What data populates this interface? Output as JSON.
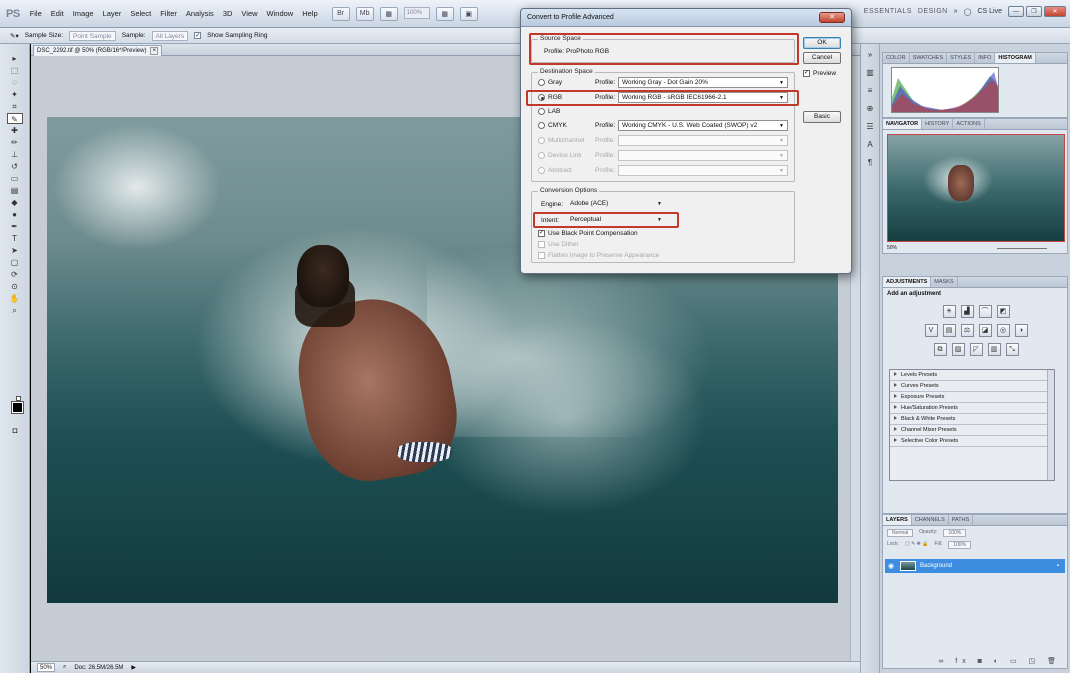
{
  "app": {
    "logo": "PS",
    "menu": [
      "File",
      "Edit",
      "Image",
      "Layer",
      "Select",
      "Filter",
      "Analysis",
      "3D",
      "View",
      "Window",
      "Help"
    ],
    "zoom": "100%",
    "workspaces": [
      "ESSENTIALS",
      "DESIGN",
      "»"
    ],
    "cslive": "CS Live"
  },
  "options_bar": {
    "sample_size_label": "Sample Size:",
    "sample_size_value": "Point Sample",
    "sample_label": "Sample:",
    "sample_value": "All Layers",
    "show_ring_label": "Show Sampling Ring"
  },
  "document": {
    "tab_title": "DSC_2292.tif @ 50% (RGB/16*/Preview)",
    "status_zoom": "50%",
    "status_doc": "Doc: 26.5M/26.5M"
  },
  "dialog": {
    "title": "Convert to Profile Advanced",
    "source_space_label": "Source Space",
    "source_profile": "Profile:  ProPhoto RGB",
    "destination_space_label": "Destination Space",
    "profile_label": "Profile:",
    "rows": [
      {
        "name": "Gray",
        "profile": "Working Gray - Dot Gain 20%",
        "selected": false,
        "enabled": true
      },
      {
        "name": "RGB",
        "profile": "Working RGB - sRGB IEC61966-2.1",
        "selected": true,
        "enabled": true
      },
      {
        "name": "LAB",
        "profile": "",
        "selected": false,
        "enabled": true
      },
      {
        "name": "CMYK",
        "profile": "Working CMYK - U.S. Web Coated (SWOP) v2",
        "selected": false,
        "enabled": true
      },
      {
        "name": "Multichannel",
        "profile": "",
        "selected": false,
        "enabled": false
      },
      {
        "name": "Device Link",
        "profile": "",
        "selected": false,
        "enabled": false
      },
      {
        "name": "Abstract",
        "profile": "",
        "selected": false,
        "enabled": false
      }
    ],
    "conversion_options_label": "Conversion Options",
    "engine_label": "Engine:",
    "engine_value": "Adobe (ACE)",
    "intent_label": "Intent:",
    "intent_value": "Perceptual",
    "use_bpc": "Use Black Point Compensation",
    "use_dither": "Use Dither",
    "flatten": "Flatten Image to Preserve Appearance",
    "ok": "OK",
    "cancel": "Cancel",
    "preview": "Preview",
    "basic": "Basic"
  },
  "panels": {
    "top_tabs": [
      "COLOR",
      "SWATCHES",
      "STYLES",
      "INFO",
      "HISTOGRAM"
    ],
    "nav_tabs": [
      "NAVIGATOR",
      "HISTORY",
      "ACTIONS"
    ],
    "nav_zoom": "50%",
    "adj_tabs": [
      "ADJUSTMENTS",
      "MASKS"
    ],
    "adj_title": "Add an adjustment",
    "presets": [
      "Levels Presets",
      "Curves Presets",
      "Exposure Presets",
      "Hue/Saturation Presets",
      "Black & White Presets",
      "Channel Mixer Presets",
      "Selective Color Presets"
    ],
    "layer_tabs": [
      "LAYERS",
      "CHANNELS",
      "PATHS"
    ],
    "blend_mode": "Normal",
    "opacity_label": "Opacity:",
    "opacity": "100%",
    "lock_label": "Lock:",
    "fill_label": "Fill:",
    "fill": "100%",
    "layer_name": "Background"
  },
  "colors": {
    "highlight": "#c0392b",
    "layer_selected": "#3d8ee0"
  }
}
